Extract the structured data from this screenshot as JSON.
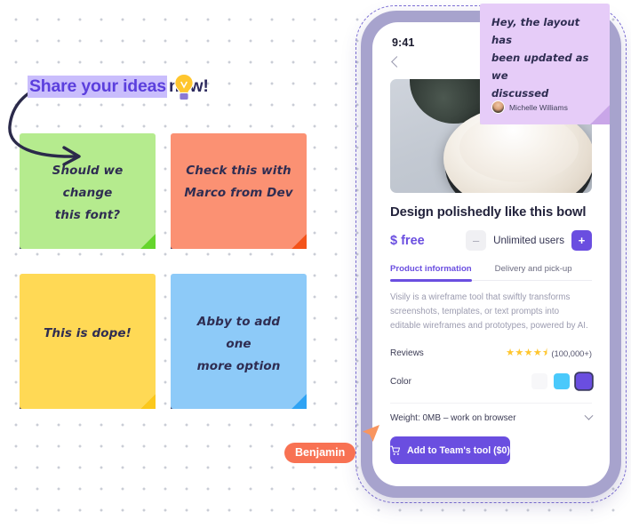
{
  "board": {
    "headline": {
      "selected_text": "Share your ideas",
      "rest_text": "now!",
      "bulb_icon": "lightbulb-icon"
    },
    "notes": [
      {
        "id": "green",
        "text_line1": "Should we change",
        "text_line2": "this font?",
        "color": "#b5eb8e"
      },
      {
        "id": "orange",
        "text_line1": "Check this with",
        "text_line2": "Marco from Dev",
        "color": "#fb9173"
      },
      {
        "id": "yellow",
        "text_line1": "This is dope!",
        "text_line2": "",
        "color": "#ffd955"
      },
      {
        "id": "blue",
        "text_line1": "Abby to add one",
        "text_line2": "more option",
        "color": "#8dcaf8"
      }
    ]
  },
  "comment": {
    "text_line1": "Hey, the layout has",
    "text_line2": "been updated as we",
    "text_line3": "discussed",
    "author": "Michelle Williams",
    "avatar_icon": "user-avatar",
    "color": "#e6ccf8"
  },
  "cursor": {
    "label": "Benjamin",
    "color": "#f87253",
    "icon": "cursor-pointer-icon"
  },
  "phone": {
    "status_time": "9:41",
    "back_icon": "chevron-left-icon",
    "product": {
      "image_alt": "ceramic-bowls-photo",
      "title": "Design polishedly like this bowl",
      "price": "$ free",
      "stepper": {
        "minus": "–",
        "label": "Unlimited users",
        "plus": "+"
      },
      "tabs": [
        {
          "label": "Product information",
          "active": true
        },
        {
          "label": "Delivery and pick-up",
          "active": false
        }
      ],
      "description": "Visily is a wireframe tool that swiftly transforms screenshots, templates, or text prompts into editable wireframes and prototypes, powered by AI.",
      "specs": {
        "reviews_label": "Reviews",
        "stars": "★★★★⯨",
        "review_count": "(100,000+)",
        "color_label": "Color",
        "swatches": [
          "#f7f7f9",
          "#4ac9fb",
          "#6a4ee0"
        ],
        "selected_swatch_index": 2,
        "weight_label": "Weight: 0MB – work on browser",
        "weight_chevron": "chevron-down-icon"
      },
      "cta": {
        "label": "Add to Team's tool ($0)",
        "icon": "shopping-cart-icon",
        "color": "#6a4ee0"
      }
    }
  }
}
